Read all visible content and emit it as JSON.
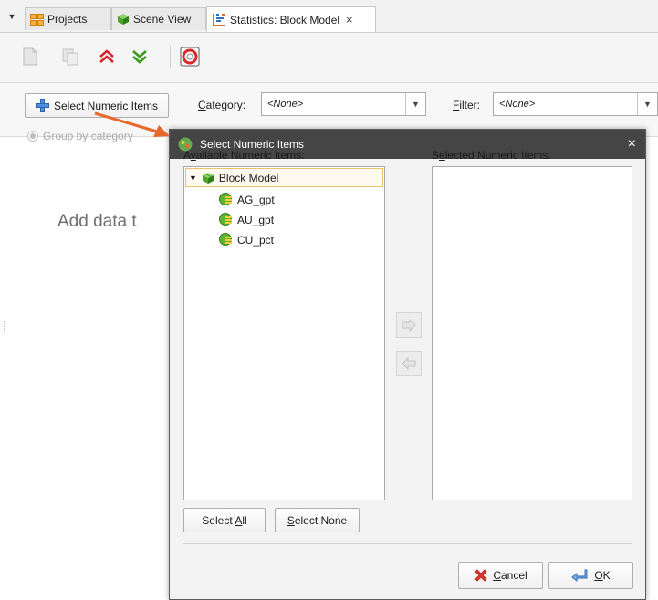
{
  "tabs": [
    {
      "label": "Projects",
      "icon": "projects-icon"
    },
    {
      "label": "Scene View",
      "icon": "cube-icon"
    },
    {
      "label": "Statistics: Block Model",
      "icon": "statistics-icon",
      "active": true,
      "close": "×"
    }
  ],
  "tab_menu_glyph": "▼",
  "toolbar": {
    "icons": [
      "document-icon",
      "copy-icon",
      "expand-all-icon",
      "collapse-all-icon",
      "help-lifebuoy-icon"
    ]
  },
  "panel": {
    "select_button": {
      "prefix": "S",
      "rest": "elect Numeric Items"
    },
    "category_label": {
      "prefix": "C",
      "rest": "ategory:"
    },
    "category_value": "<None>",
    "filter_label": {
      "prefix": "F",
      "rest": "ilter:"
    },
    "filter_value": "<None>",
    "group_by": "Group by category",
    "hint": "Add data t"
  },
  "dialog": {
    "title": "Select Numeric Items",
    "close": "×",
    "available_label": {
      "pre": "A",
      "u": "v",
      "post": "ailable Numeric Items:"
    },
    "selected_label": {
      "pre": "S",
      "u": "e",
      "post": "lected Numeric Items:"
    },
    "tree": {
      "root": "Block Model",
      "items": [
        "AG_gpt",
        "AU_gpt",
        "CU_pct"
      ]
    },
    "select_all": {
      "pre": "Select ",
      "u": "A",
      "post": "ll"
    },
    "select_none": {
      "u": "S",
      "post": "elect None"
    },
    "cancel": {
      "u": "C",
      "post": "ancel"
    },
    "ok": {
      "u": "O",
      "post": "K"
    }
  },
  "colors": {
    "accent_orange": "#e8672a",
    "title_bar": "#454545",
    "tree_selection_border": "#e8c46a",
    "expand_red": "#d9262b",
    "collapse_green": "#3a9a1c"
  }
}
